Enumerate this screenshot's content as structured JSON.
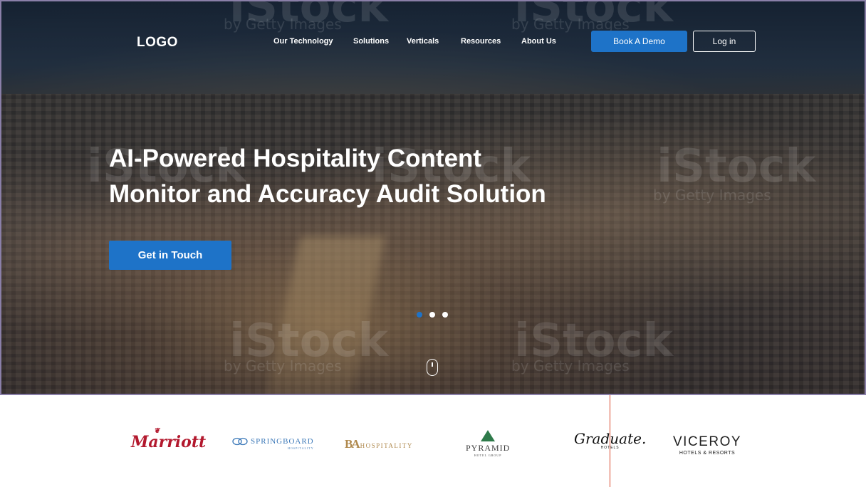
{
  "header": {
    "logo": "LOGO",
    "nav": [
      "Our Technology",
      "Solutions",
      "Verticals",
      "Resources",
      "About Us"
    ],
    "book_demo": "Book A Demo",
    "login": "Log in"
  },
  "hero": {
    "headline_line1": "AI-Powered Hospitality Content",
    "headline_line2": "Monitor and Accuracy Audit Solution",
    "cta": "Get in Touch",
    "carousel": {
      "slides": 3,
      "active": 1
    },
    "watermark_brand": "iStock",
    "watermark_by": "by Getty Images"
  },
  "brands": {
    "marriott": "Marriott",
    "springboard": "SPRINGBOARD",
    "springboard_sub": "HOSPITALITY",
    "ba_mark": "BA",
    "ba_text": "HOSPITALITY",
    "pyramid": "PYRAMID",
    "pyramid_sub": "HOTEL GROUP",
    "graduate": "Graduate.",
    "graduate_sub": "HOTELS",
    "viceroy": "VICEROY",
    "viceroy_sub": "HOTELS & RESORTS"
  },
  "colors": {
    "primary": "#1e73c8",
    "marriott_red": "#b3192e",
    "springboard_blue": "#3b78b8",
    "ba_gold": "#b08a4f",
    "pyramid_green": "#2e7a4a"
  }
}
